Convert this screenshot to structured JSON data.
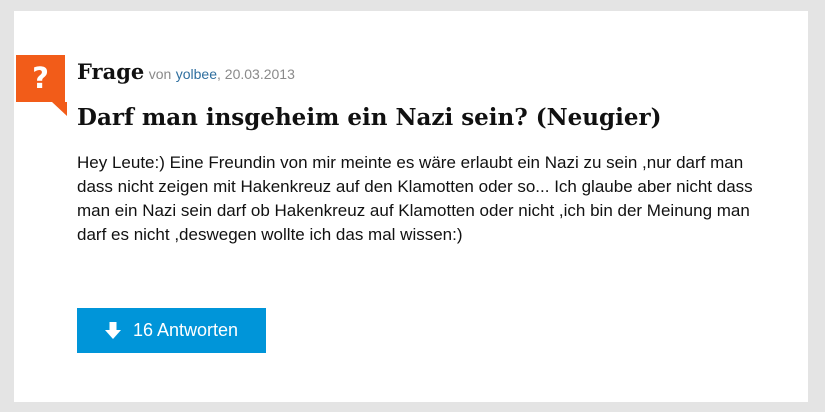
{
  "badge": {
    "symbol": "?",
    "color": "#f25c19"
  },
  "question": {
    "type_label": "Frage",
    "by_label": "von",
    "user": "yolbee",
    "date": ", 20.03.2013",
    "title": "Darf man insgeheim ein Nazi sein? (Neugier)",
    "body": "Hey Leute:) Eine Freundin von mir meinte es wäre erlaubt ein Nazi zu sein ,nur darf man dass nicht zeigen mit Hakenkreuz auf den Klamotten oder so... Ich glaube aber nicht dass man ein Nazi sein darf ob Hakenkreuz auf Klamotten oder nicht ,ich bin der Meinung man darf es nicht ,deswegen wollte ich das mal wissen:)"
  },
  "answers_button": {
    "label": "16 Antworten",
    "icon": "arrow-down-icon",
    "color": "#0095d9"
  }
}
